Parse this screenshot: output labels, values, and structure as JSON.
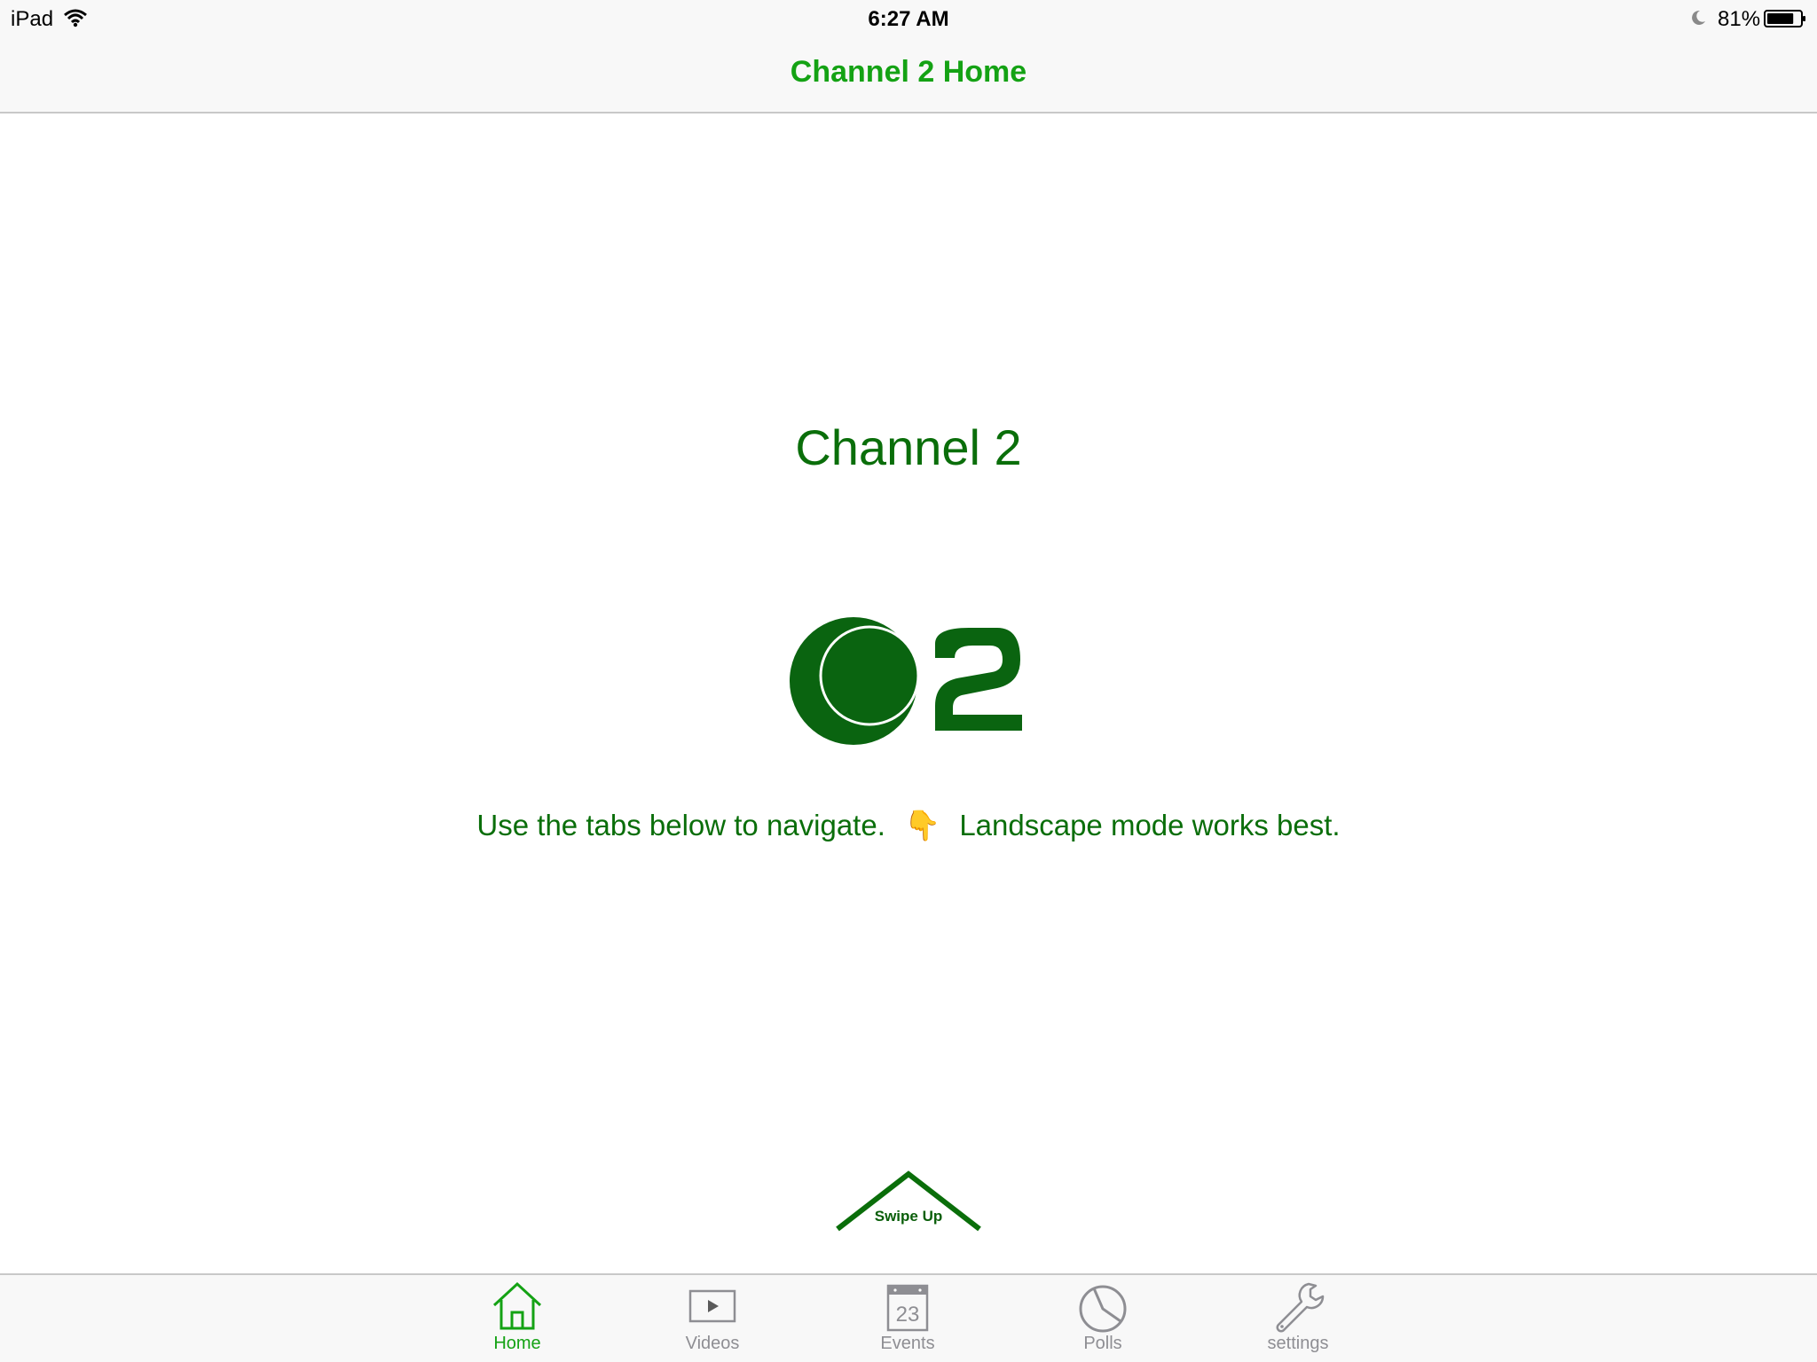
{
  "status_bar": {
    "device": "iPad",
    "time": "6:27 AM",
    "battery_percent": "81%",
    "battery_level": 0.81,
    "icons": [
      "wifi-icon",
      "moon-icon",
      "battery-icon"
    ]
  },
  "nav": {
    "title": "Channel 2 Home"
  },
  "main": {
    "heading": "Channel 2",
    "logo_icon": "channel-2-logo",
    "instructions_before": "Use the tabs below to navigate.",
    "pointing_emoji": "👇",
    "instructions_after": "Landscape mode works best.",
    "swipe_label": "Swipe Up"
  },
  "tabs": [
    {
      "label": "Home",
      "icon": "house-icon",
      "active": true
    },
    {
      "label": "Videos",
      "icon": "play-icon",
      "active": false
    },
    {
      "label": "Events",
      "icon": "calendar-icon",
      "active": false,
      "icon_text": "23"
    },
    {
      "label": "Polls",
      "icon": "pie-chart-icon",
      "active": false
    },
    {
      "label": "settings",
      "icon": "wrench-icon",
      "active": false
    }
  ],
  "colors": {
    "accent": "#14a214",
    "brand_dark_green": "#0a6e0a",
    "inactive": "#8e8e93",
    "bar_background": "#f8f8f8"
  }
}
